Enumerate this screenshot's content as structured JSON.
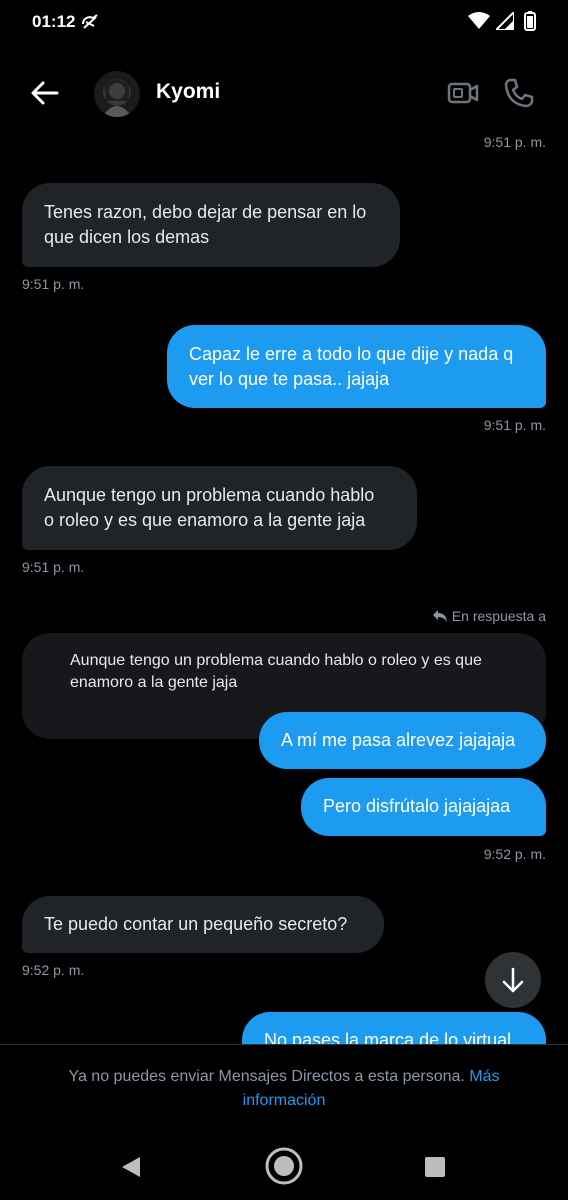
{
  "status_bar": {
    "time": "01:12"
  },
  "header": {
    "contact_name": "Kyomi"
  },
  "messages": [
    {
      "type": "timestamp_right",
      "time": "9:51 p. m."
    },
    {
      "type": "received",
      "text_lines": [
        "Tenes razon, debo dejar de pensar en lo",
        "que dicen los demas"
      ],
      "time": "9:51 p. m."
    },
    {
      "type": "sent",
      "text_lines": [
        "Capaz le erre a todo lo que dije y nada q",
        "ver lo que te pasa.. jajaja"
      ],
      "time": "9:51 p. m."
    },
    {
      "type": "received",
      "text_lines": [
        "Aunque tengo un problema cuando hablo",
        "o roleo y es que enamoro a la gente jaja"
      ],
      "time": "9:51 p. m."
    },
    {
      "type": "reply_label",
      "text": "En respuesta a"
    },
    {
      "type": "quoted",
      "text_lines": [
        "Aunque tengo un problema cuando hablo o roleo y es que",
        "enamoro a la gente jaja"
      ]
    },
    {
      "type": "sent",
      "text_lines": [
        "A mí me pasa alrevez jajajaja"
      ]
    },
    {
      "type": "sent",
      "text_lines": [
        "Pero disfrútalo jajajajaa"
      ],
      "time": "9:52 p. m."
    },
    {
      "type": "received",
      "text_lines": [
        "Te puedo contar un pequeño secreto?"
      ],
      "time": "9:52 p. m."
    },
    {
      "type": "sent",
      "text_lines": [
        "No pases la marca de lo virtual"
      ]
    }
  ],
  "footer": {
    "notice": "Ya no puedes enviar Mensajes Directos a esta persona.",
    "link_line1": "Más",
    "link_line2": "información"
  },
  "icons": {
    "back": "arrow-left-icon",
    "video": "video-camera-icon",
    "call": "phone-icon",
    "reply": "reply-arrow-icon",
    "scroll_down": "arrow-down-icon"
  },
  "colors": {
    "accent": "#1d9bf0",
    "received_bubble": "#202327",
    "quote_bg": "#16181c",
    "muted_text": "#8b98a5"
  }
}
